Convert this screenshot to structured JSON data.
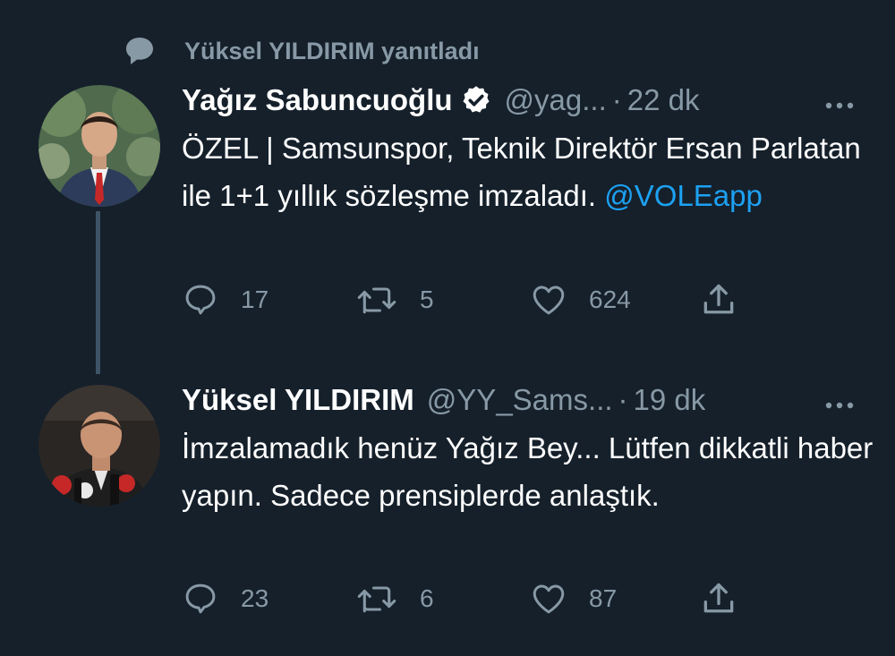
{
  "social_context": {
    "text": "Yüksel YILDIRIM yanıtladı",
    "icon": "speech-bubble-icon"
  },
  "tweets": [
    {
      "name": "Yağız Sabuncuoğlu",
      "verified": true,
      "handle": "@yag...",
      "separator": "·",
      "time": "22 dk",
      "body_text": "ÖZEL | Samsunspor, Teknik Direktör Ersan Parlatan ile 1+1 yıllık sözleşme imzaladı. ",
      "mention": "@VOLEapp",
      "counts": {
        "replies": "17",
        "retweets": "5",
        "likes": "624"
      }
    },
    {
      "name": "Yüksel YILDIRIM",
      "verified": false,
      "handle": "@YY_Sams...",
      "separator": "·",
      "time": "19 dk",
      "body_text": "İmzalamadık henüz Yağız Bey... Lütfen dikkatli haber yapın. Sadece prensiplerde anlaştık.",
      "counts": {
        "replies": "23",
        "retweets": "6",
        "likes": "87"
      }
    }
  ],
  "colors": {
    "background": "#15202b",
    "secondary_text": "#8899a6",
    "link": "#1da1f2",
    "thread_line": "#3d5466"
  },
  "icons": [
    "speech-bubble-icon",
    "verified-badge-icon",
    "more-icon",
    "reply-icon",
    "retweet-icon",
    "like-icon",
    "share-icon"
  ]
}
